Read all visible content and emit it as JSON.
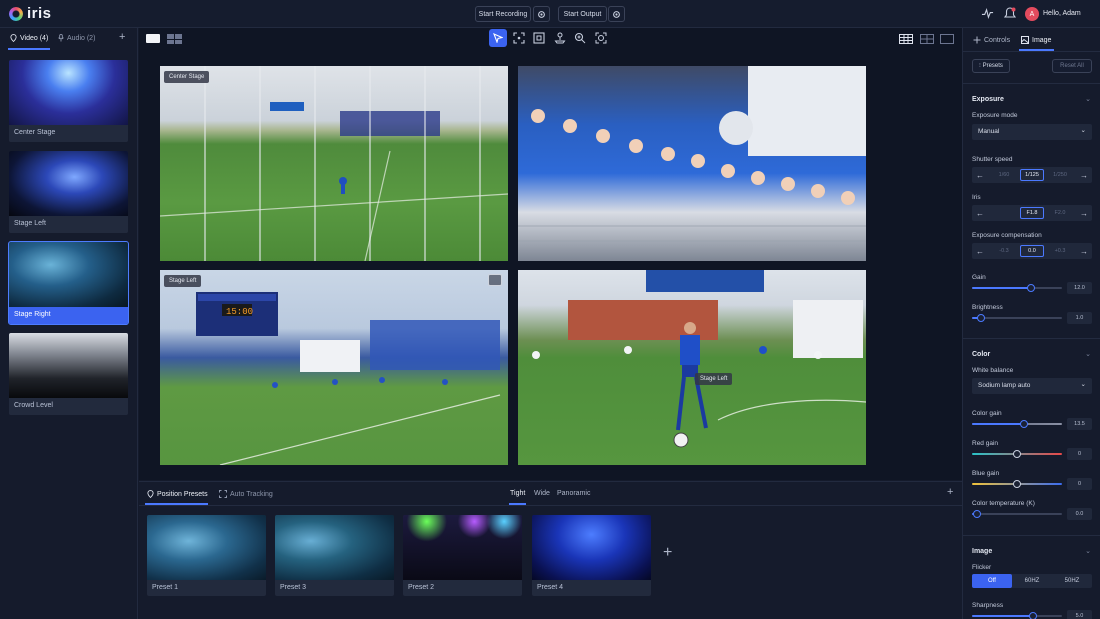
{
  "app": {
    "title": "iris"
  },
  "header": {
    "start_recording": "Start Recording",
    "start_output": "Start Output",
    "greeting": "Hello, Adam",
    "avatar_initial": "A",
    "accent": "#3b63f0",
    "avatar_color": "#e34b5e"
  },
  "left": {
    "tabs": [
      {
        "label": "Video (4)"
      },
      {
        "label": "Audio (2)"
      }
    ],
    "sources": [
      {
        "label": "Center Stage"
      },
      {
        "label": "Stage Left"
      },
      {
        "label": "Stage Right"
      },
      {
        "label": "Crowd Level"
      }
    ],
    "selected_index": 2
  },
  "viewer": {
    "tags": [
      "Center Stage",
      "Stage Left",
      "Stage Left"
    ]
  },
  "bottom": {
    "tabs": [
      {
        "label": "Position Presets"
      },
      {
        "label": "Auto Tracking"
      }
    ],
    "zoom_tabs": [
      {
        "label": "Tight"
      },
      {
        "label": "Wide"
      },
      {
        "label": "Panoramic"
      }
    ],
    "presets": [
      {
        "label": "Preset 1"
      },
      {
        "label": "Preset 3"
      },
      {
        "label": "Preset 2"
      },
      {
        "label": "Preset 4"
      }
    ]
  },
  "right": {
    "tabs": [
      {
        "label": "Controls"
      },
      {
        "label": "Image"
      }
    ],
    "presets_btn": "Presets",
    "reset_btn": "Reset All",
    "exposure": {
      "title": "Exposure",
      "mode_label": "Exposure mode",
      "mode_value": "Manual",
      "shutter_label": "Shutter speed",
      "shutter": [
        "1/60",
        "1/125",
        "1/250"
      ],
      "iris_label": "Iris",
      "iris": [
        "",
        "F1.8",
        "F2.0"
      ],
      "comp_label": "Exposure compensation",
      "comp": [
        "-0.3",
        "0.0",
        "+0.3"
      ],
      "gain_label": "Gain",
      "gain_value": "12.0",
      "gain_level": 0.65,
      "brightness_label": "Brightness",
      "brightness_value": "1.0",
      "brightness_level": 0.1
    },
    "color": {
      "title": "Color",
      "wb_label": "White balance",
      "wb_value": "Sodium lamp auto",
      "color_gain_label": "Color gain",
      "color_gain_value": "13.5",
      "color_gain_level": 0.58,
      "red_gain_label": "Red gain",
      "red_gain_value": "0",
      "red_gain_level": 0.5,
      "blue_gain_label": "Blue gain",
      "blue_gain_value": "0",
      "blue_gain_level": 0.5,
      "temp_label": "Color temperature (K)",
      "temp_value": "0.0",
      "temp_level": 0.05
    },
    "image": {
      "title": "Image",
      "flicker_label": "Flicker",
      "flicker": [
        "Off",
        "60HZ",
        "50HZ"
      ],
      "sharpness_label": "Sharpness",
      "sharpness_value": "5.0",
      "sharpness_level": 0.68
    }
  }
}
